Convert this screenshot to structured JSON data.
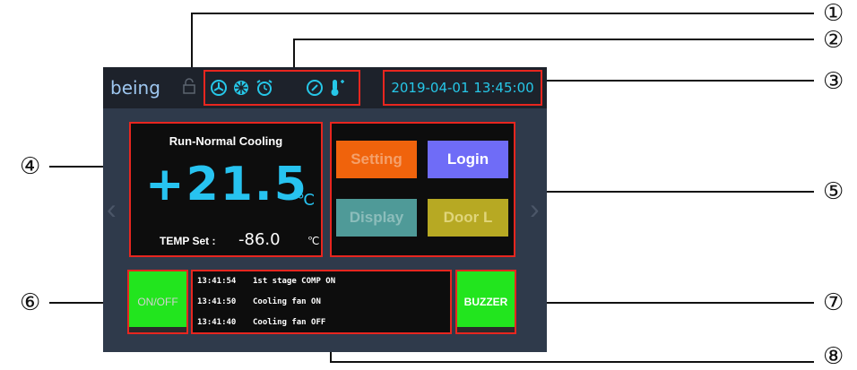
{
  "callouts": [
    "①",
    "②",
    "③",
    "④",
    "⑤",
    "⑥",
    "⑦",
    "⑧"
  ],
  "header": {
    "logo": "being",
    "status_icons": [
      "lock-icon",
      "fan-icon",
      "defrost-icon",
      "alarm-icon",
      "gauge-icon",
      "thermometer-icon"
    ],
    "datetime": "2019-04-01 13:45:00"
  },
  "temperature": {
    "status": "Run-Normal Cooling",
    "current": "+21.5",
    "unit": "℃",
    "set_label": "TEMP Set :",
    "set_value": "-86.0",
    "set_unit": "℃"
  },
  "buttons": {
    "setting": "Setting",
    "login": "Login",
    "display": "Display",
    "door": "Door L",
    "onoff": "ON/OFF",
    "buzzer": "BUZZER"
  },
  "colors": {
    "setting": "#f0630c",
    "login": "#6f6cf7",
    "display": "#4f9a98",
    "door": "#b7a923",
    "green": "#22e51e",
    "accent": "#26c7e8",
    "highlight": "#e8261f"
  },
  "log": [
    {
      "time": "13:41:54",
      "msg": "1st stage COMP ON"
    },
    {
      "time": "13:41:50",
      "msg": "Cooling fan ON"
    },
    {
      "time": "13:41:40",
      "msg": "Cooling fan OFF"
    }
  ]
}
